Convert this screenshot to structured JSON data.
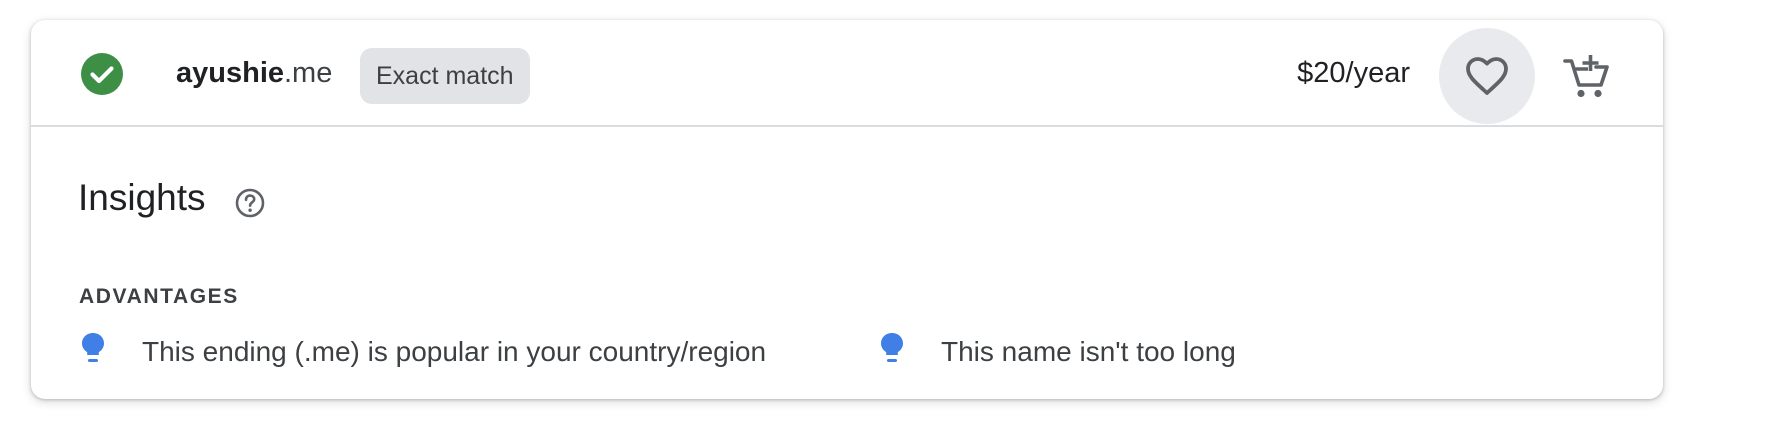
{
  "result": {
    "domain_sld": "ayushie",
    "domain_tld": ".me",
    "badge": "Exact match",
    "price": "$20/year",
    "status": "available",
    "colors": {
      "status_green": "#3c8f45",
      "badge_bg": "#e1e3e6",
      "fav_bg": "#e8eaed"
    },
    "icons": {
      "status": "check-circle-icon",
      "favorite": "heart-outline-icon",
      "cart": "add-shopping-cart-icon"
    }
  },
  "insights": {
    "title": "Insights",
    "help_icon": "help-circle-icon",
    "section_label": "ADVANTAGES",
    "advantages": [
      {
        "icon": "lightbulb-icon",
        "text": "This ending (.me) is popular in your country/region"
      },
      {
        "icon": "lightbulb-icon",
        "text": "This name isn't too long"
      }
    ],
    "colors": {
      "bulb_blue": "#3f7fe6"
    }
  }
}
